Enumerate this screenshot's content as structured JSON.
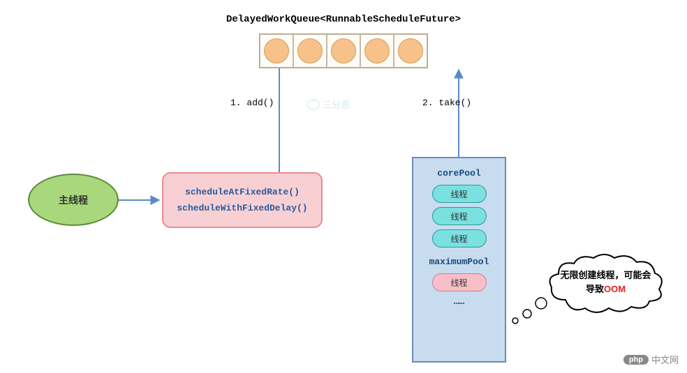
{
  "queue": {
    "title": "DelayedWorkQueue<RunnableScheduleFuture>",
    "slot_count": 5
  },
  "labels": {
    "add": "1. add()",
    "take": "2. take()"
  },
  "main_thread": {
    "label": "主线程"
  },
  "schedule_box": {
    "method1": "scheduleAtFixedRate()",
    "method2": "scheduleWithFixedDelay()"
  },
  "pool": {
    "core_label": "corePool",
    "core_threads": [
      "线程",
      "线程",
      "线程"
    ],
    "max_label": "maximumPool",
    "max_threads": [
      "线程"
    ],
    "ellipsis": "……"
  },
  "cloud": {
    "line1": "无限创建线程，可能会",
    "line2_prefix": "导致",
    "line2_emphasis": "OOM"
  },
  "watermark": {
    "text": "三分恶"
  },
  "footer": {
    "badge": "php",
    "text": "中文网"
  },
  "chart_data": {
    "type": "diagram",
    "title": "ScheduledThreadPoolExecutor flow",
    "nodes": [
      {
        "id": "main",
        "label": "主线程",
        "shape": "ellipse",
        "color": "#a8d87b"
      },
      {
        "id": "sched",
        "label": "scheduleAtFixedRate() / scheduleWithFixedDelay()",
        "shape": "rounded-rect",
        "color": "#f8d0d4"
      },
      {
        "id": "queue",
        "label": "DelayedWorkQueue<RunnableScheduleFuture>",
        "shape": "array",
        "slots": 5,
        "color": "#f7c28a"
      },
      {
        "id": "pool",
        "label": "corePool / maximumPool",
        "shape": "rect",
        "color": "#c8dcf0",
        "children": [
          {
            "group": "corePool",
            "items": [
              "线程",
              "线程",
              "线程"
            ],
            "color": "#7ae0e0"
          },
          {
            "group": "maximumPool",
            "items": [
              "线程",
              "……"
            ],
            "color": "#f7c0c8"
          }
        ]
      },
      {
        "id": "note",
        "label": "无限创建线程，可能会导致OOM",
        "shape": "cloud"
      }
    ],
    "edges": [
      {
        "from": "main",
        "to": "sched",
        "label": ""
      },
      {
        "from": "sched",
        "to": "queue",
        "label": "1. add()"
      },
      {
        "from": "pool",
        "to": "queue",
        "label": "2. take()"
      },
      {
        "from": "note",
        "to": "pool",
        "style": "thought-bubbles"
      }
    ]
  }
}
